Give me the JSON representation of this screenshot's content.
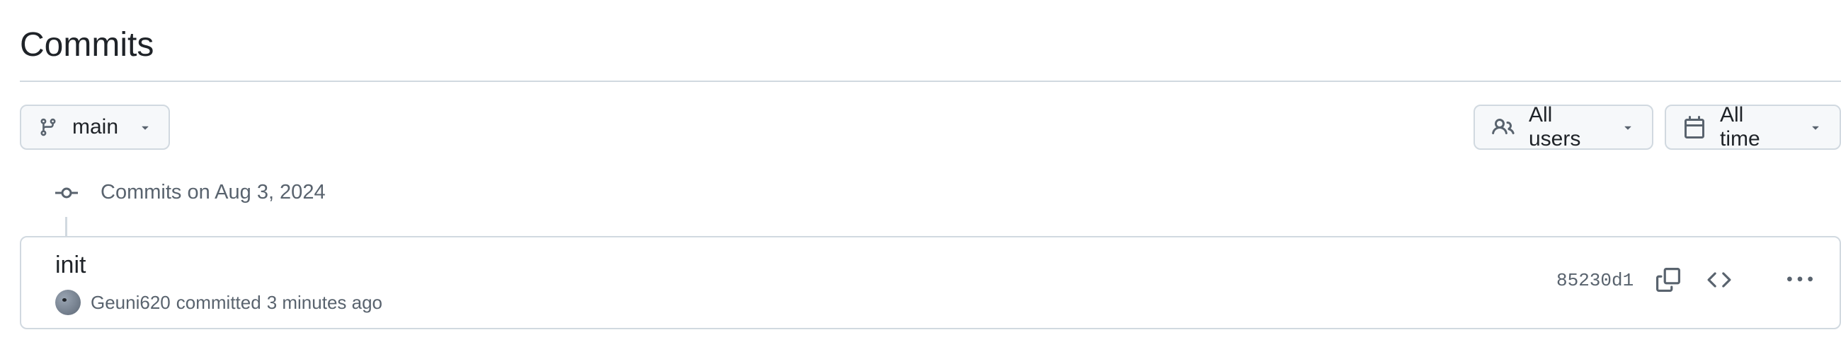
{
  "page": {
    "title": "Commits"
  },
  "filters": {
    "branch": {
      "label": "main",
      "icon": "git-branch-icon"
    },
    "users": {
      "label": "All users",
      "icon": "people-icon"
    },
    "time": {
      "label": "All time",
      "icon": "calendar-icon"
    }
  },
  "commit_group": {
    "header": "Commits on Aug 3, 2024",
    "icon": "git-commit-icon"
  },
  "commits": [
    {
      "message": "init",
      "author": "Geuni620",
      "action": "committed",
      "time": "3 minutes ago",
      "sha": "85230d1",
      "actions": [
        "copy-icon",
        "code-icon",
        "kebab-horizontal-icon"
      ]
    }
  ],
  "colors": {
    "border": "#d1d9e0",
    "muted_text": "#59636e",
    "primary_text": "#1f2328",
    "button_bg": "#f6f8fa"
  }
}
